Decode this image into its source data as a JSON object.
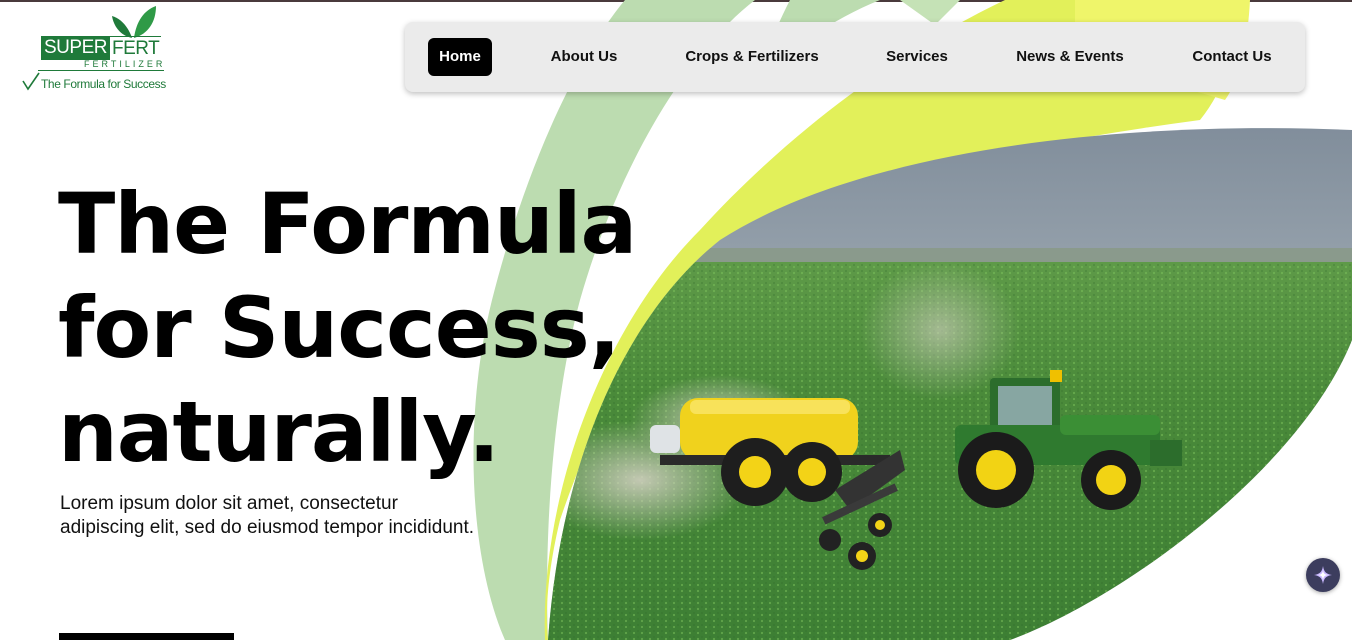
{
  "brand": {
    "word_left": "SUPER",
    "word_right": "FERT",
    "subtitle": "FERTILIZER",
    "tagline": "The Formula for Success"
  },
  "nav": {
    "items": [
      {
        "label": "Home",
        "active": true
      },
      {
        "label": "About Us",
        "active": false
      },
      {
        "label": "Crops & Fertilizers",
        "active": false
      },
      {
        "label": "Services",
        "active": false
      },
      {
        "label": "News & Events",
        "active": false
      },
      {
        "label": "Contact Us",
        "active": false
      }
    ]
  },
  "hero": {
    "title_lines": [
      "The Formula",
      "for Success,",
      "naturally."
    ],
    "description": "Lorem ipsum dolor sit amet, consectetur adipiscing elit, sed do eiusmod tempor incididunt."
  },
  "icons": {
    "logo_leaf": "leaf-icon",
    "logo_check": "checkmark-icon",
    "assistant": "sparkle-icon"
  },
  "colors": {
    "brand_green": "#1f7a3a",
    "leaf_light_green": "#bcdcb0",
    "leaf_yellow": "#e2f05a",
    "nav_background": "#ebebeb",
    "active_nav": "#000000"
  }
}
